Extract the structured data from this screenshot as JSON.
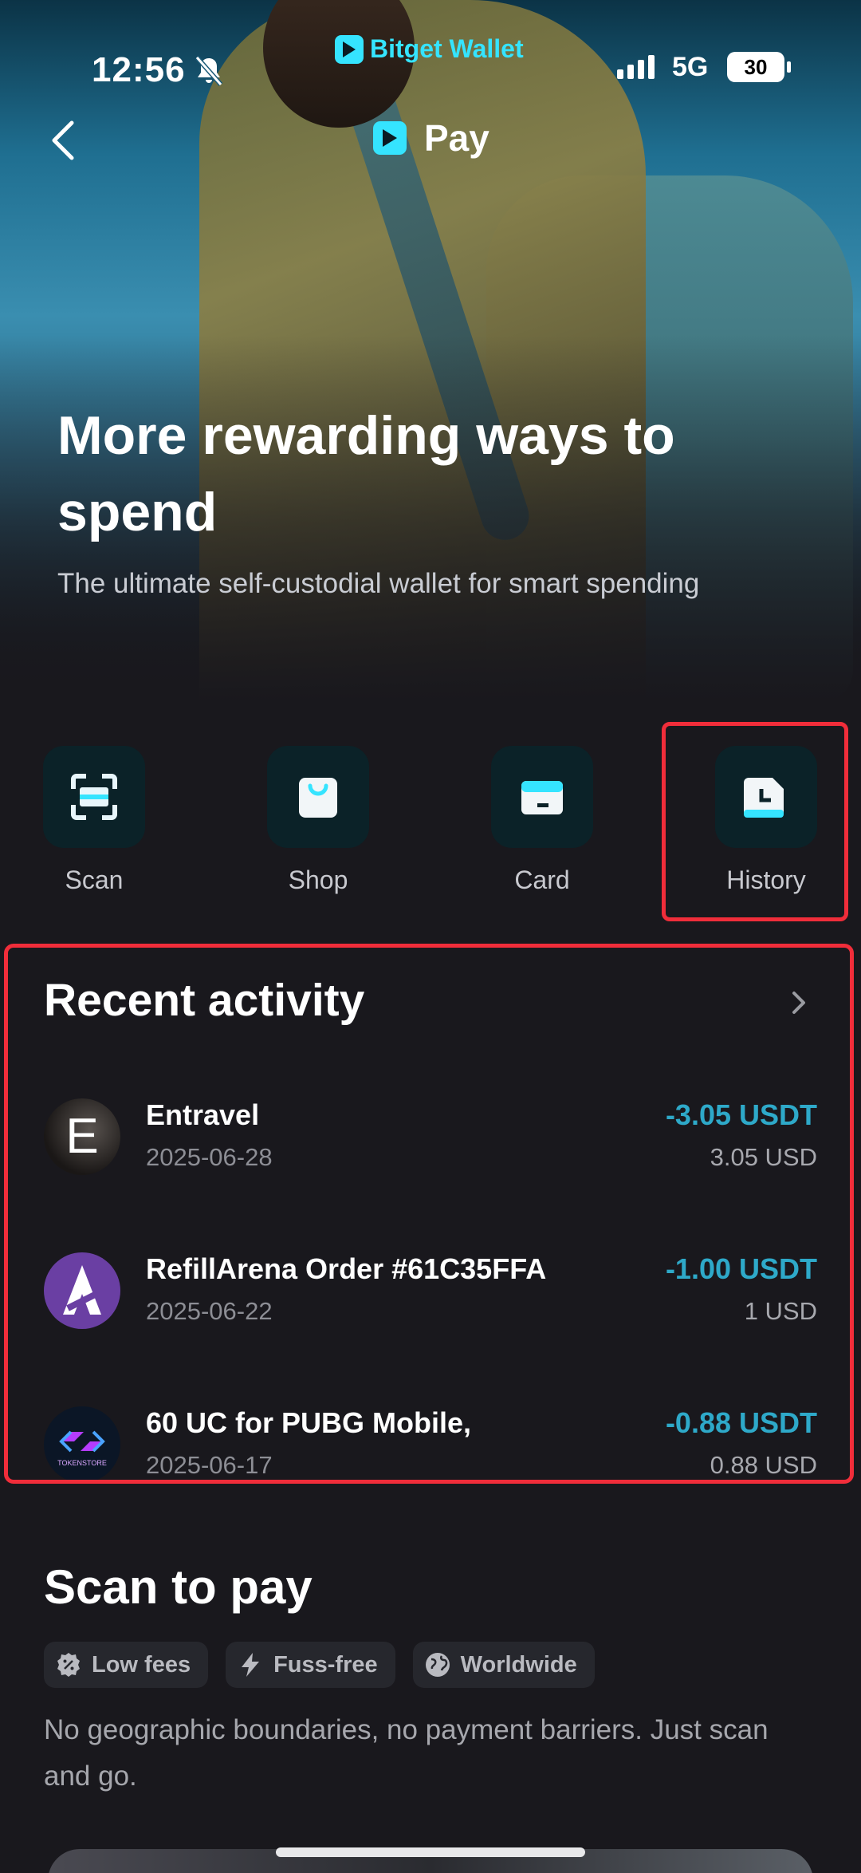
{
  "status": {
    "time": "12:56",
    "network": "5G",
    "battery": "30",
    "brand": "Bitget Wallet"
  },
  "nav": {
    "title": "Pay"
  },
  "hero": {
    "title": "More rewarding ways to spend",
    "subtitle": "The ultimate self-custodial wallet for smart spending"
  },
  "actions": [
    {
      "label": "Scan",
      "icon": "scan-icon"
    },
    {
      "label": "Shop",
      "icon": "shopping-bag-icon"
    },
    {
      "label": "Card",
      "icon": "card-icon"
    },
    {
      "label": "History",
      "icon": "clock-icon"
    }
  ],
  "recent": {
    "title": "Recent activity",
    "items": [
      {
        "name": "Entravel",
        "date": "2025-06-28",
        "amount": "-3.05 USDT",
        "usd": "3.05 USD",
        "avatar_letter": "E"
      },
      {
        "name": "RefillArena Order #61C35FFA",
        "date": "2025-06-22",
        "amount": "-1.00 USDT",
        "usd": "1 USD"
      },
      {
        "name": "60 UC for PUBG Mobile,",
        "date": "2025-06-17",
        "amount": "-0.88 USDT",
        "usd": "0.88 USD",
        "avatar_text": "TOKENSTORE"
      }
    ]
  },
  "scan": {
    "title": "Scan to pay",
    "chips": [
      {
        "label": "Low fees",
        "icon": "percent-badge-icon"
      },
      {
        "label": "Fuss-free",
        "icon": "lightning-icon"
      },
      {
        "label": "Worldwide",
        "icon": "globe-icon"
      }
    ],
    "description": "No geographic boundaries, no payment barriers. Just scan and go."
  },
  "colors": {
    "accent": "#35e4ff",
    "amount": "#2ea9c9",
    "highlight": "#f02d3a",
    "background": "#19181d"
  }
}
